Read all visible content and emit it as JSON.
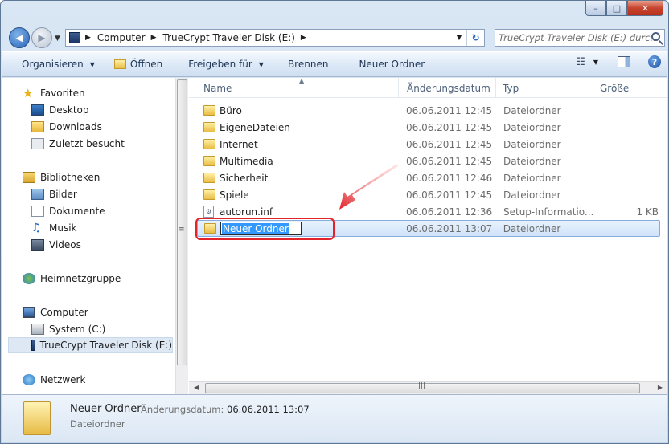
{
  "window": {
    "minimize": "–",
    "maximize": "□",
    "close": "✕"
  },
  "address": {
    "crumbs": [
      "Computer",
      "TrueCrypt Traveler Disk (E:)"
    ],
    "sep": "▶"
  },
  "search": {
    "placeholder": "TrueCrypt Traveler Disk (E:) durc..."
  },
  "toolbar": {
    "organize": "Organisieren",
    "open": "Öffnen",
    "share": "Freigeben für",
    "burn": "Brennen",
    "new_folder": "Neuer Ordner",
    "help": "?"
  },
  "sidebar": {
    "favorites": {
      "label": "Favoriten",
      "items": [
        "Desktop",
        "Downloads",
        "Zuletzt besucht"
      ]
    },
    "libraries": {
      "label": "Bibliotheken",
      "items": [
        "Bilder",
        "Dokumente",
        "Musik",
        "Videos"
      ]
    },
    "homegroup": "Heimnetzgruppe",
    "computer": {
      "label": "Computer",
      "items": [
        "System (C:)",
        "TrueCrypt Traveler Disk (E:)"
      ]
    },
    "network": "Netzwerk"
  },
  "columns": {
    "name": "Name",
    "date": "Änderungsdatum",
    "type": "Typ",
    "size": "Größe"
  },
  "files": [
    {
      "name": "Büro",
      "date": "06.06.2011 12:45",
      "type": "Dateiordner",
      "size": ""
    },
    {
      "name": "EigeneDateien",
      "date": "06.06.2011 12:45",
      "type": "Dateiordner",
      "size": ""
    },
    {
      "name": "Internet",
      "date": "06.06.2011 12:45",
      "type": "Dateiordner",
      "size": ""
    },
    {
      "name": "Multimedia",
      "date": "06.06.2011 12:45",
      "type": "Dateiordner",
      "size": ""
    },
    {
      "name": "Sicherheit",
      "date": "06.06.2011 12:46",
      "type": "Dateiordner",
      "size": ""
    },
    {
      "name": "Spiele",
      "date": "06.06.2011 12:45",
      "type": "Dateiordner",
      "size": ""
    },
    {
      "name": "autorun.inf",
      "date": "06.06.2011 12:36",
      "type": "Setup-Informatio...",
      "size": "1 KB"
    },
    {
      "name": "Neuer Ordner",
      "date": "06.06.2011 13:07",
      "type": "Dateiordner",
      "size": ""
    }
  ],
  "details": {
    "name": "Neuer Ordner",
    "date_label": "Änderungsdatum:",
    "date": "06.06.2011 13:07",
    "type": "Dateiordner"
  },
  "colors": {
    "highlight": "#e2232a",
    "selection": "#3399ff"
  }
}
